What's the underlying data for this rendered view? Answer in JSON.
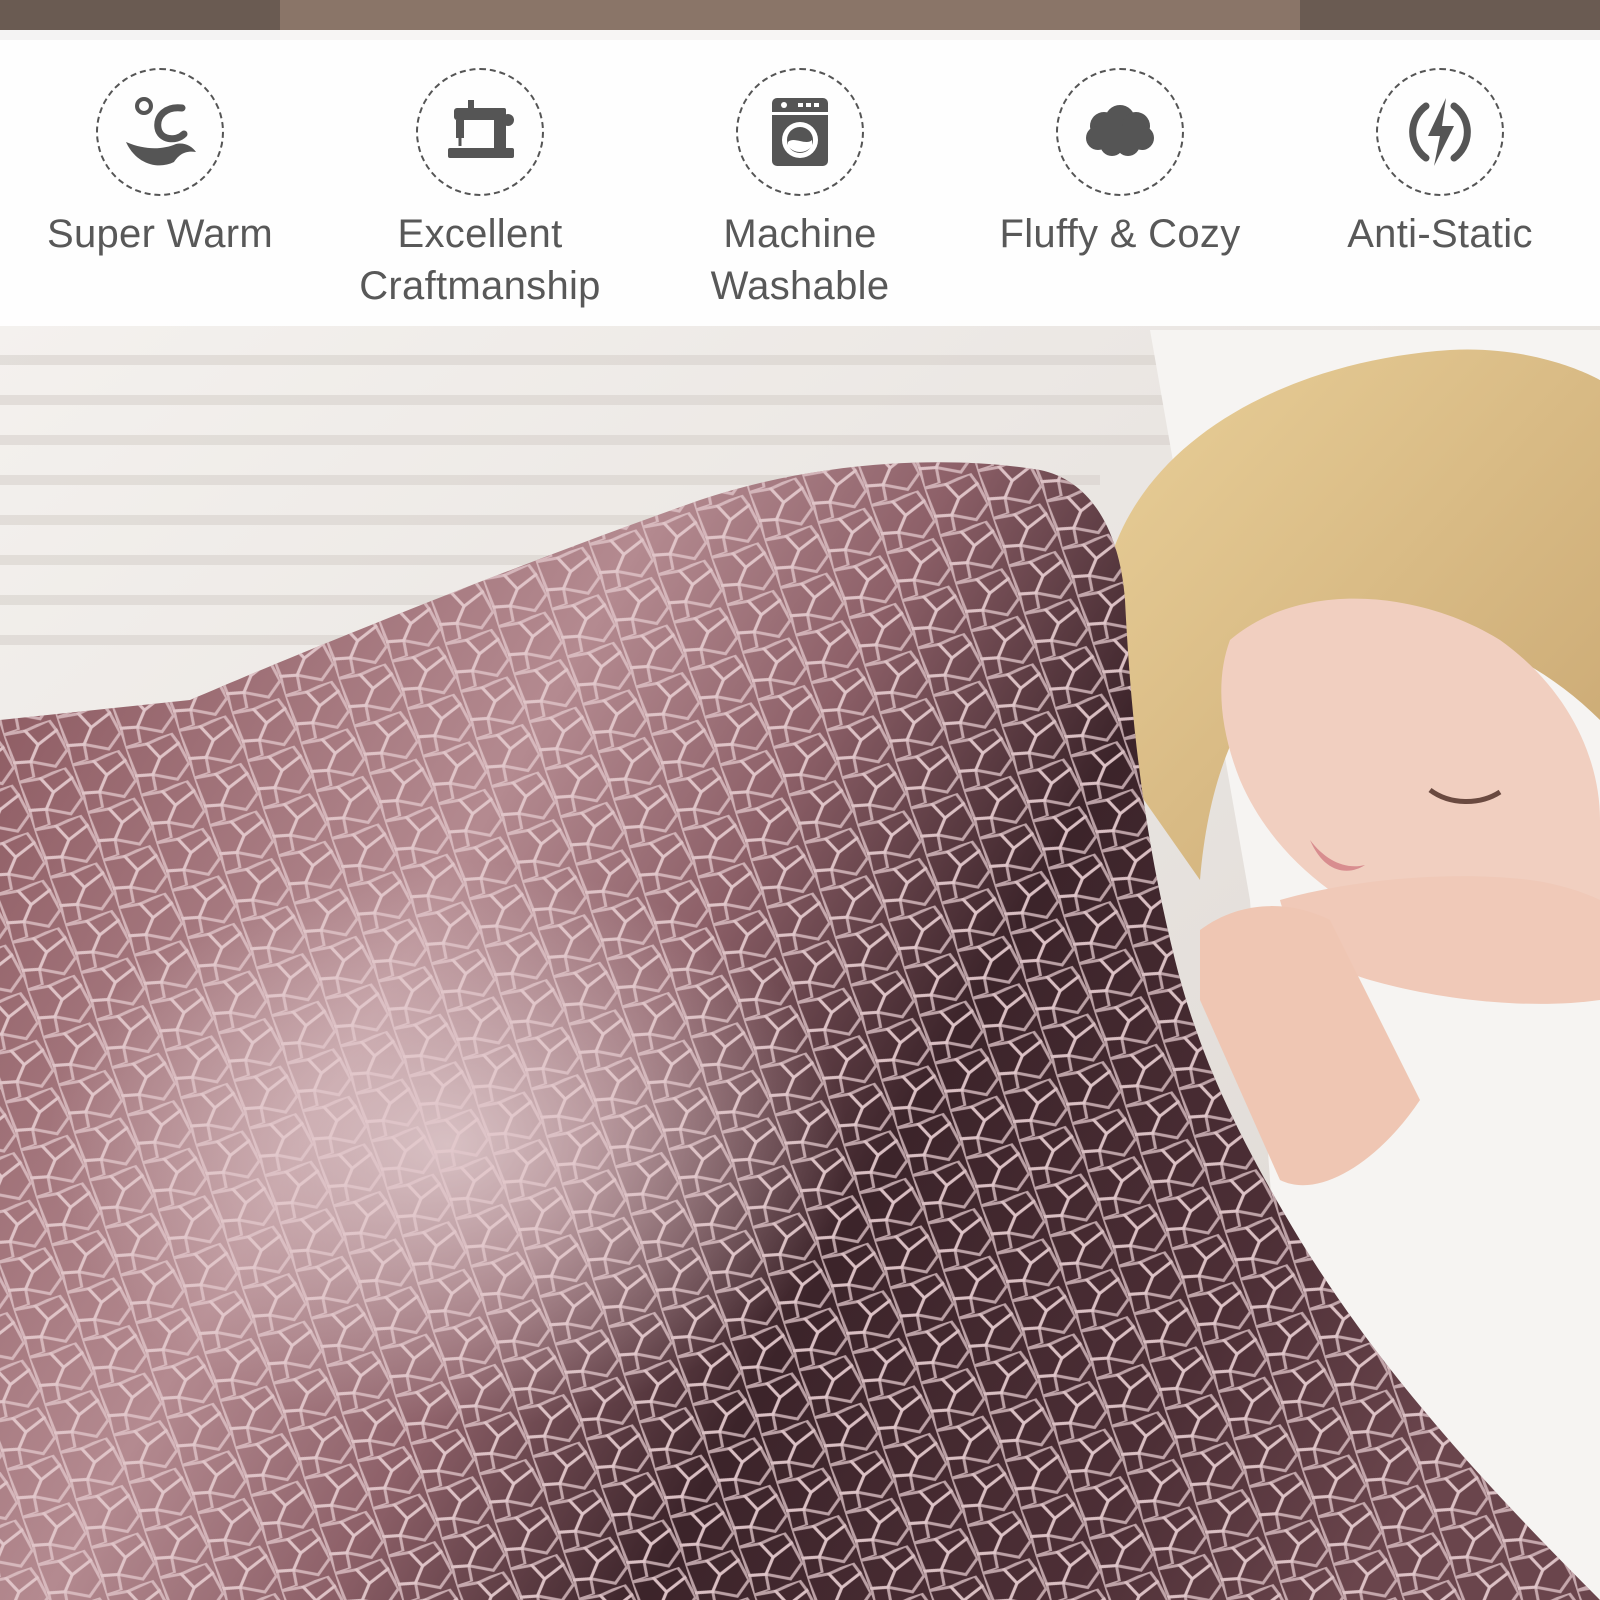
{
  "colors": {
    "banner_background": "#ffffff",
    "icon_color": "#555555",
    "label_color": "#585858",
    "blanket_light": "#c9a6aa",
    "blanket_mid": "#8a5a62",
    "blanket_dark": "#3a2228"
  },
  "features": [
    {
      "icon": "warm-drop-icon",
      "label": "Super Warm"
    },
    {
      "icon": "sewing-machine-icon",
      "label": "Excellent Craftmanship"
    },
    {
      "icon": "washing-machine-icon",
      "label": "Machine Washable"
    },
    {
      "icon": "cloud-icon",
      "label": "Fluffy & Cozy"
    },
    {
      "icon": "lightning-icon",
      "label": "Anti-Static"
    }
  ]
}
